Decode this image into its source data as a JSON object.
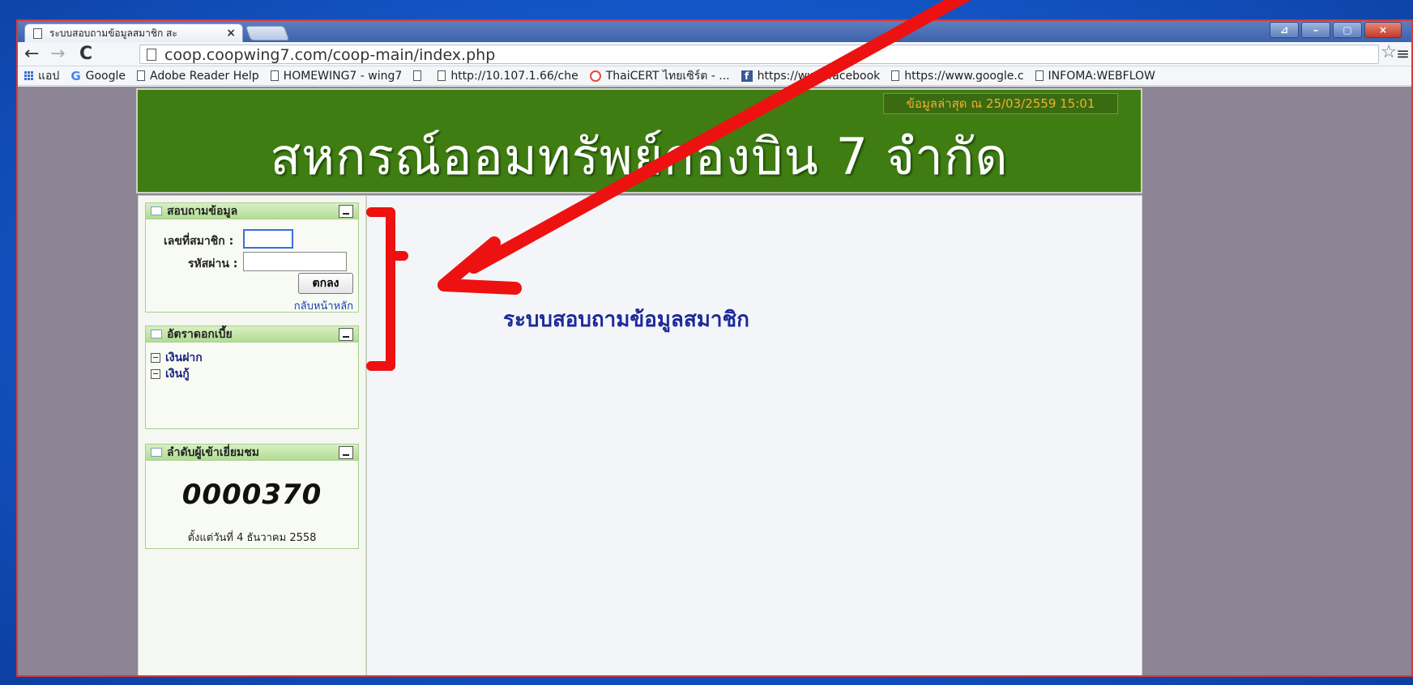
{
  "browser": {
    "tab_title": "ระบบสอบถามข้อมูลสมาชิก สะ",
    "tab_close": "×",
    "url": "coop.coopwing7.com/coop-main/index.php",
    "window_buttons": {
      "minimize": "–",
      "restore": "▢",
      "close": "×",
      "extra": "⊿"
    },
    "nav": {
      "back": "←",
      "forward": "→",
      "reload": "C"
    },
    "star": "☆",
    "menu": "≡",
    "bookmarks": [
      {
        "label": "แอป",
        "icon": "apps-icon"
      },
      {
        "label": "Google",
        "icon": "google-icon"
      },
      {
        "label": "Adobe Reader Help",
        "icon": "page-icon"
      },
      {
        "label": "HOMEWING7 - wing7",
        "icon": "page-icon"
      },
      {
        "label": "",
        "icon": "page-icon"
      },
      {
        "label": "http://10.107.1.66/che",
        "icon": "page-icon"
      },
      {
        "label": "ThaiCERT ไทยเซิร์ต - ...",
        "icon": "thaicert-icon"
      },
      {
        "label": "https://www.facebook",
        "icon": "facebook-icon"
      },
      {
        "label": "https://www.google.c",
        "icon": "page-icon"
      },
      {
        "label": "INFOMA:WEBFLOW",
        "icon": "page-icon"
      }
    ],
    "bookmark_more": "»"
  },
  "header": {
    "title": "สหกรณ์ออมทรัพย์กองบิน 7 จำกัด",
    "last_update": "ข้อมูลล่าสุด ณ 25/03/2559 15:01"
  },
  "login_panel": {
    "title": "สอบถามข้อมูล",
    "member_label": "เลขที่สมาชิก :",
    "member_value": "",
    "password_label": "รหัสผ่าน :",
    "password_value": "",
    "submit": "ตกลง",
    "back_home": "กลับหน้าหลัก"
  },
  "rate_panel": {
    "title": "อัตราดอกเบี้ย",
    "items": [
      "เงินฝาก",
      "เงินกู้"
    ]
  },
  "visitor_panel": {
    "title": "ลำดับผู้เข้าเยี่ยมชม",
    "count": "0000370",
    "since": "ตั้งแต่วันที่ 4 ธันวาคม 2558"
  },
  "main": {
    "title": "ระบบสอบถามข้อมูลสมาชิก"
  },
  "colors": {
    "header_bg": "#3f7d12",
    "annotation_red": "#ee1111",
    "panel_head": "#b2dc92",
    "main_title": "#1c2a9a"
  }
}
